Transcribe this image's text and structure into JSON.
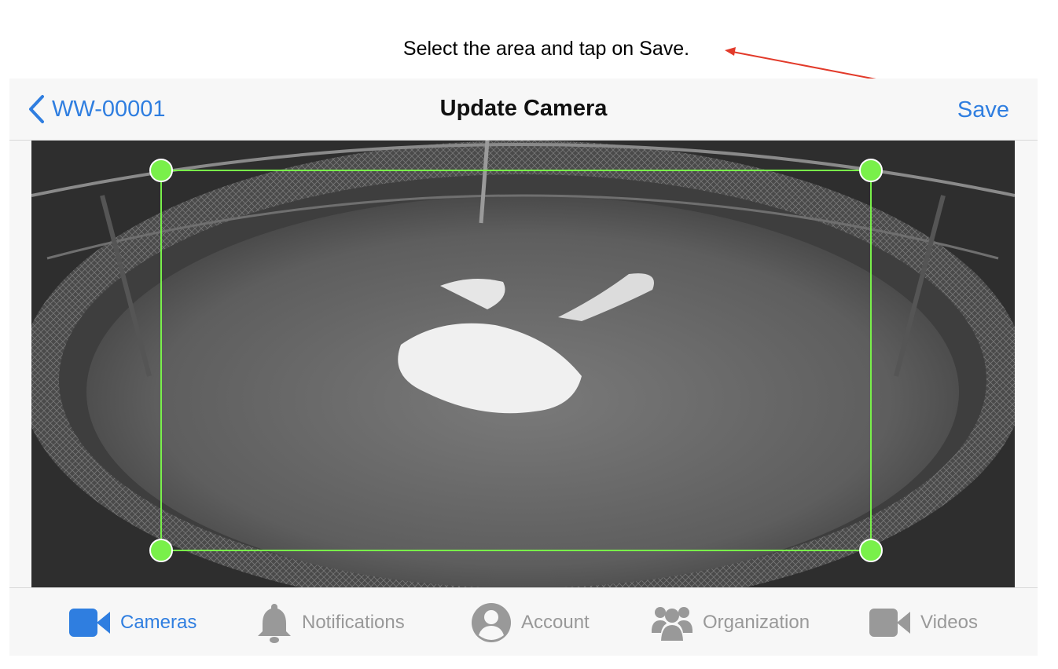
{
  "annotation": {
    "text": "Select the area and tap on Save."
  },
  "navbar": {
    "back_label": "WW-00001",
    "title": "Update Camera",
    "save_label": "Save"
  },
  "tabs": [
    {
      "label": "Cameras",
      "icon": "video-camera-icon",
      "active": true
    },
    {
      "label": "Notifications",
      "icon": "bell-icon",
      "active": false
    },
    {
      "label": "Account",
      "icon": "user-circle-icon",
      "active": false
    },
    {
      "label": "Organization",
      "icon": "users-group-icon",
      "active": false
    },
    {
      "label": "Videos",
      "icon": "video-camera-icon",
      "active": false
    }
  ],
  "colors": {
    "accent": "#2f7ee0",
    "selection": "#79f04a",
    "annotation_arrow": "#e23a2a",
    "inactive_tab": "#999999"
  }
}
